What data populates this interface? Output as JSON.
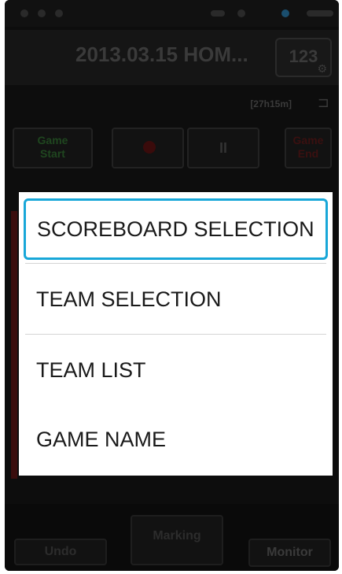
{
  "app": {
    "title": "2013.03.15 HOM...",
    "score_button_label": "123",
    "remaining_time": "[27h15m]"
  },
  "controls": {
    "game_start": [
      "Game",
      "Start"
    ],
    "pause_symbol": "II",
    "game_end": [
      "Game",
      "End"
    ]
  },
  "bottom": {
    "undo": "Undo",
    "marking": "Marking",
    "monitor": "Monitor"
  },
  "menu": {
    "items": [
      {
        "label": "SCOREBOARD SELECTION",
        "selected": true
      },
      {
        "label": "TEAM SELECTION",
        "selected": false
      },
      {
        "label": "TEAM LIST",
        "selected": false
      },
      {
        "label": "GAME NAME",
        "selected": false
      }
    ]
  },
  "colors": {
    "highlight": "#18a7d8",
    "dialog_bg": "#ffffff",
    "screen_bg": "#0d0d0d"
  },
  "icons": {
    "settings": "gear-icon",
    "power": "plug-icon",
    "record": "record-icon"
  }
}
